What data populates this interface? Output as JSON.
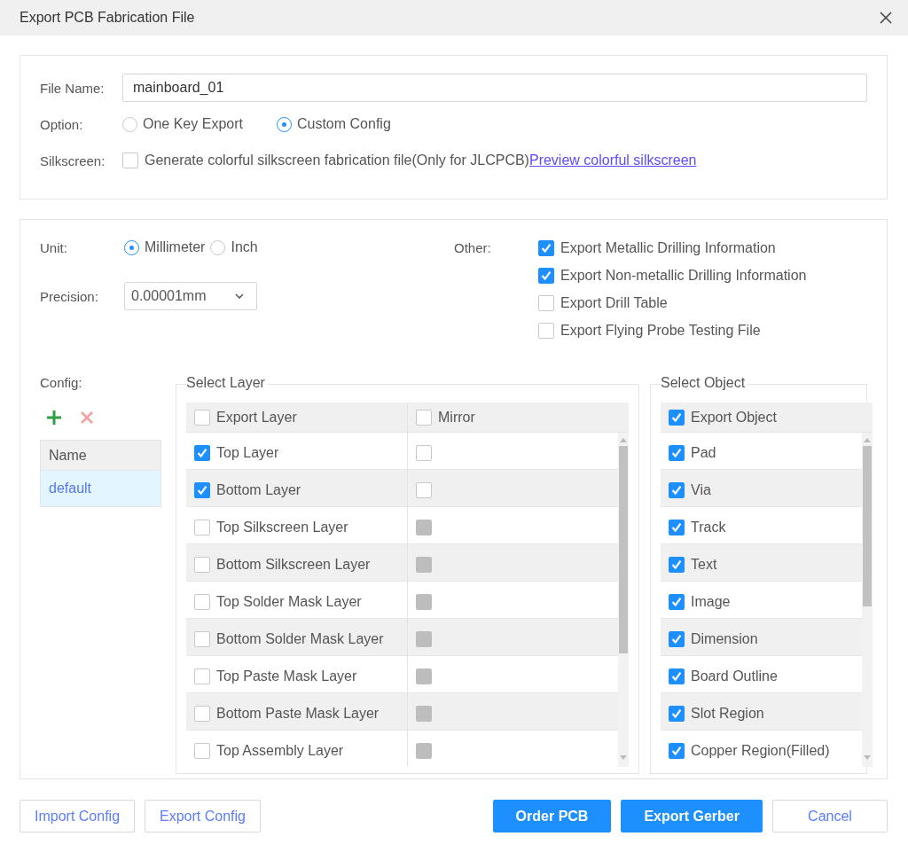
{
  "window": {
    "title": "Export PCB Fabrication File"
  },
  "file_name": {
    "label": "File Name:",
    "value": "mainboard_01"
  },
  "option": {
    "label": "Option:",
    "choices": [
      {
        "label": "One Key Export",
        "selected": false
      },
      {
        "label": "Custom Config",
        "selected": true
      }
    ]
  },
  "silkscreen": {
    "label": "Silkscreen:",
    "checked": false,
    "text": "Generate colorful silkscreen fabrication file(Only for JLCPCB)",
    "link": "Preview colorful silkscreen"
  },
  "unit": {
    "label": "Unit:",
    "choices": [
      {
        "label": "Millimeter",
        "selected": true
      },
      {
        "label": "Inch",
        "selected": false
      }
    ]
  },
  "precision": {
    "label": "Precision:",
    "value": "0.00001mm"
  },
  "other": {
    "label": "Other:",
    "items": [
      {
        "label": "Export Metallic Drilling Information",
        "checked": true
      },
      {
        "label": "Export Non-metallic Drilling Information",
        "checked": true
      },
      {
        "label": "Export Drill Table",
        "checked": false
      },
      {
        "label": "Export Flying Probe Testing File",
        "checked": false
      }
    ]
  },
  "config": {
    "label": "Config:",
    "column": "Name",
    "items": [
      {
        "name": "default",
        "selected": true
      }
    ]
  },
  "select_layer": {
    "title": "Select Layer",
    "header": {
      "label": "Export Layer",
      "checked": false
    },
    "mirror_header": {
      "label": "Mirror",
      "checked": false
    },
    "rows": [
      {
        "label": "Top Layer",
        "checked": true,
        "mirror": {
          "checked": false,
          "disabled": false
        }
      },
      {
        "label": "Bottom Layer",
        "checked": true,
        "mirror": {
          "checked": false,
          "disabled": false
        }
      },
      {
        "label": "Top Silkscreen Layer",
        "checked": false,
        "mirror": {
          "checked": false,
          "disabled": true
        }
      },
      {
        "label": "Bottom Silkscreen Layer",
        "checked": false,
        "mirror": {
          "checked": false,
          "disabled": true
        }
      },
      {
        "label": "Top Solder Mask Layer",
        "checked": false,
        "mirror": {
          "checked": false,
          "disabled": true
        }
      },
      {
        "label": "Bottom Solder Mask Layer",
        "checked": false,
        "mirror": {
          "checked": false,
          "disabled": true
        }
      },
      {
        "label": "Top Paste Mask Layer",
        "checked": false,
        "mirror": {
          "checked": false,
          "disabled": true
        }
      },
      {
        "label": "Bottom Paste Mask Layer",
        "checked": false,
        "mirror": {
          "checked": false,
          "disabled": true
        }
      },
      {
        "label": "Top Assembly Layer",
        "checked": false,
        "mirror": {
          "checked": false,
          "disabled": true
        }
      }
    ]
  },
  "select_object": {
    "title": "Select Object",
    "header": {
      "label": "Export Object",
      "checked": true
    },
    "rows": [
      {
        "label": "Pad",
        "checked": true
      },
      {
        "label": "Via",
        "checked": true
      },
      {
        "label": "Track",
        "checked": true
      },
      {
        "label": "Text",
        "checked": true
      },
      {
        "label": "Image",
        "checked": true
      },
      {
        "label": "Dimension",
        "checked": true
      },
      {
        "label": "Board Outline",
        "checked": true
      },
      {
        "label": "Slot Region",
        "checked": true
      },
      {
        "label": "Copper Region(Filled)",
        "checked": true
      }
    ]
  },
  "buttons": [
    {
      "label": "Import Config",
      "kind": "secondary"
    },
    {
      "label": "Export Config",
      "kind": "secondary"
    },
    {
      "label": "Order PCB",
      "kind": "primary"
    },
    {
      "label": "Export Gerber",
      "kind": "primary"
    },
    {
      "label": "Cancel",
      "kind": "secondary"
    }
  ]
}
